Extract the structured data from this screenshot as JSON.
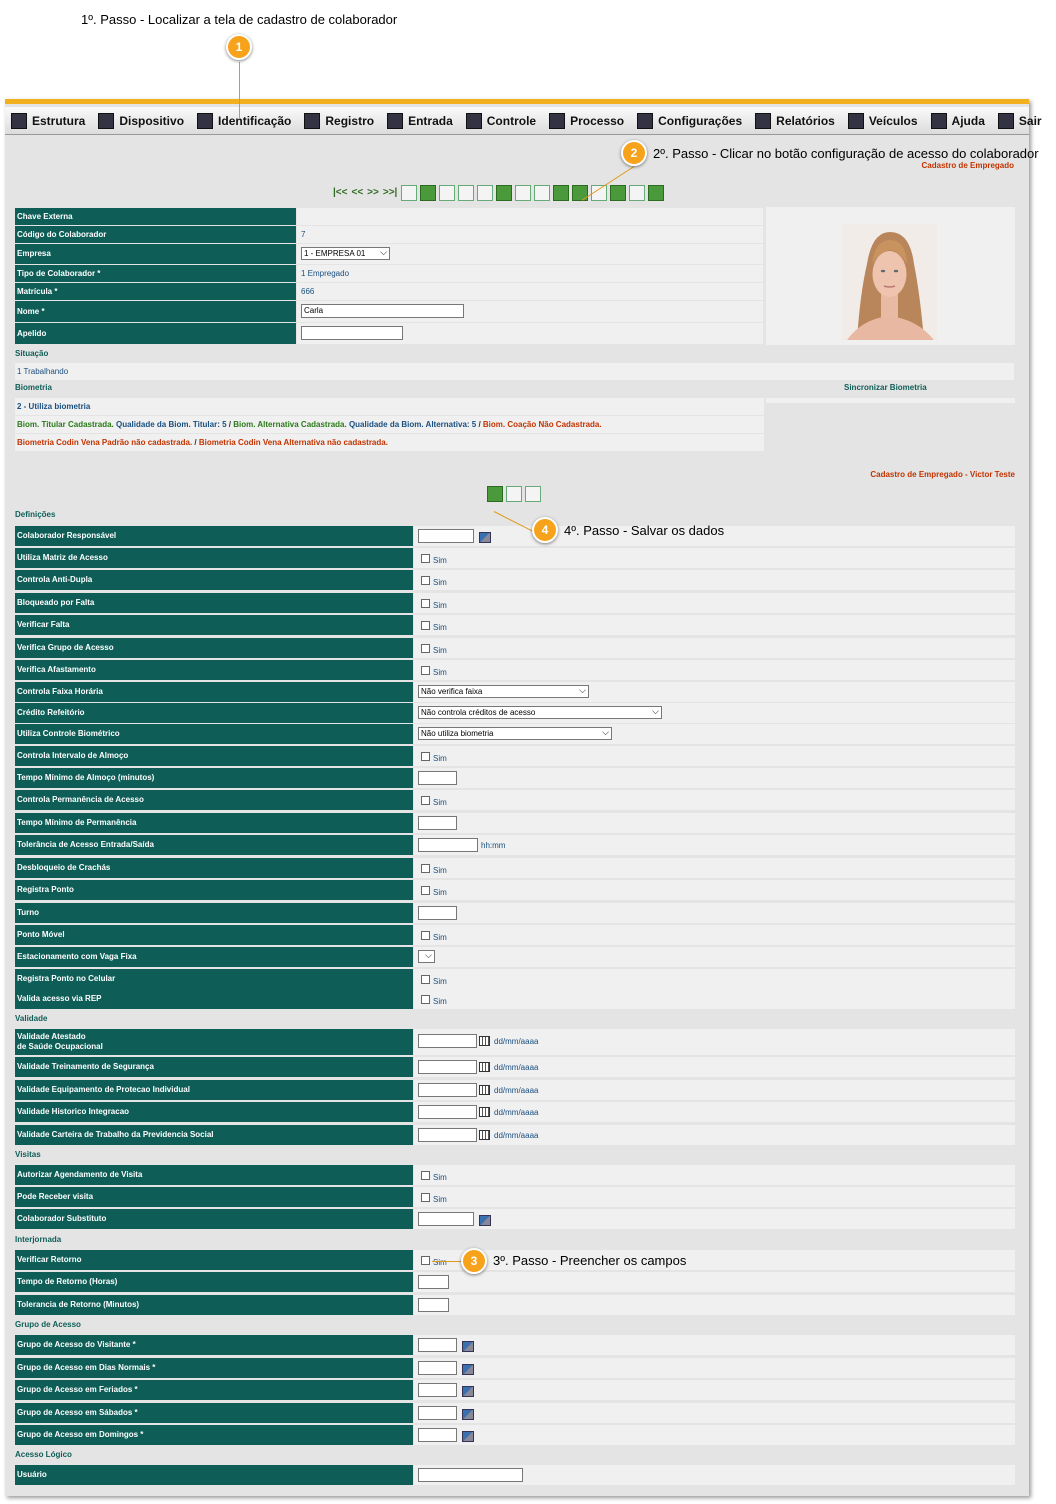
{
  "annotations": {
    "step1": "1º. Passo - Localizar a tela de cadastro de colaborador",
    "step2": "2º. Passo - Clicar no botão configuração de acesso do colaborador",
    "step3": "3º. Passo - Preencher os campos",
    "step4": "4º. Passo - Salvar os dados",
    "markers": [
      "1",
      "2",
      "3",
      "4"
    ]
  },
  "menu": [
    {
      "label": "Estrutura",
      "icon": "structure-icon"
    },
    {
      "label": "Dispositivo",
      "icon": "device-icon"
    },
    {
      "label": "Identificação",
      "icon": "identification-icon"
    },
    {
      "label": "Registro",
      "icon": "register-icon"
    },
    {
      "label": "Entrada",
      "icon": "entry-icon"
    },
    {
      "label": "Controle",
      "icon": "control-icon"
    },
    {
      "label": "Processo",
      "icon": "process-icon"
    },
    {
      "label": "Configurações",
      "icon": "settings-icon"
    },
    {
      "label": "Relatórios",
      "icon": "reports-icon"
    },
    {
      "label": "Veículos",
      "icon": "vehicles-icon"
    },
    {
      "label": "Ajuda",
      "icon": "help-icon"
    },
    {
      "label": "Sair",
      "icon": "exit-icon"
    }
  ],
  "page_title": "Cadastro de Empregado",
  "nav_glyphs": {
    "first": "|<<",
    "prev": "<<",
    "next": ">>",
    "last": ">>|"
  },
  "colaborador": {
    "chave_externa_label": "Chave Externa",
    "codigo_label": "Código do Colaborador",
    "codigo": "7",
    "empresa_label": "Empresa",
    "empresa": "1 - EMPRESA 01",
    "tipo_label": "Tipo de Colaborador *",
    "tipo": "1 Empregado",
    "matricula_label": "Matrícula *",
    "matricula": "666",
    "nome_label": "Nome *",
    "nome": "Carla",
    "apelido_label": "Apelido"
  },
  "situacao": {
    "label": "Situação",
    "value": "1 Trabalhando"
  },
  "biometria": {
    "label": "Biometria",
    "sync_link": "Sincronizar Biometria",
    "value": "2 - Utiliza biometria",
    "status_parts": [
      {
        "text": "Biom. Titular Cadastrada.",
        "color": "#2a7a1a"
      },
      {
        "text": " Qualidade da Biom. Titular: 5",
        "color": "#1a4f80"
      },
      {
        "text": " / ",
        "color": "#333333"
      },
      {
        "text": "Biom. Alternativa Cadastrada.",
        "color": "#2a7a1a"
      },
      {
        "text": " Qualidade da Biom. Alternativa: 5",
        "color": "#1a4f80"
      },
      {
        "text": " / ",
        "color": "#333333"
      },
      {
        "text": "Biom. Coação Não Cadastrada.",
        "color": "#c33300"
      }
    ],
    "codin_parts": [
      {
        "text": "Biometria Codin Vena Padrão não cadastrada.",
        "color": "#c33300"
      },
      {
        "text": " / ",
        "color": "#333333"
      },
      {
        "text": "Biometria Codin Vena Alternativa não cadastrada.",
        "color": "#c33300"
      }
    ]
  },
  "access_title": "Cadastro de Empregado - Victor Teste",
  "sections": {
    "definicoes": "Definições",
    "validade": "Validade",
    "visitas": "Visitas",
    "interjornada": "Interjornada",
    "grupo_acesso": "Grupo de Acesso",
    "acesso_logico": "Acesso Lógico"
  },
  "checkbox_label": "Sim",
  "date_hint": "dd/mm/aaaa",
  "time_hint": "hh:mm",
  "fields": {
    "colaborador_responsavel": "Colaborador Responsável",
    "utiliza_matriz": "Utiliza Matriz de Acesso",
    "anti_dupla": "Controla Anti-Dupla",
    "bloqueado_falta": "Bloqueado por Falta",
    "verificar_falta": "Verificar Falta",
    "verifica_grupo": "Verifica Grupo de Acesso",
    "verifica_afastamento": "Verifica Afastamento",
    "faixa_horaria": "Controla Faixa Horária",
    "faixa_horaria_value": "Não verifica faixa",
    "credito_refeitorio": "Crédito Refeitório",
    "credito_refeitorio_value": "Não controla créditos de acesso",
    "controle_biometrico": "Utiliza Controle Biométrico",
    "controle_biometrico_value": "Não utiliza biometria",
    "intervalo_almoco": "Controla Intervalo de Almoço",
    "tempo_almoco": "Tempo Mínimo de Almoço (minutos)",
    "permanencia": "Controla Permanência de Acesso",
    "tempo_permanencia": "Tempo Mínimo de Permanência",
    "tolerancia_entrada_saida": "Tolerância de Acesso Entrada/Saída",
    "desbloqueio_crachas": "Desbloqueio de Crachás",
    "registra_ponto": "Registra Ponto",
    "turno": "Turno",
    "ponto_movel": "Ponto Móvel",
    "vaga_fixa": "Estacionamento com Vaga Fixa",
    "ponto_celular": "Registra Ponto no Celular",
    "valida_rep": "Valida acesso via REP",
    "atestado_1": "Validade Atestado",
    "atestado_2": "de Saúde Ocupacional",
    "treinamento": "Validade Treinamento de Segurança",
    "epi": "Validade Equipamento de Protecao Individual",
    "integracao": "Validade Historico Integracao",
    "carteira": "Validade Carteira de Trabalho da Previdencia Social",
    "agendamento_visita": "Autorizar Agendamento de Visita",
    "receber_visita": "Pode Receber visita",
    "substituto": "Colaborador Substituto",
    "verificar_retorno": "Verificar Retorno",
    "tempo_retorno": "Tempo de Retorno (Horas)",
    "tolerancia_retorno": "Tolerancia de Retorno (Minutos)",
    "grupo_visitante": "Grupo de Acesso do Visitante *",
    "grupo_normais": "Grupo de Acesso em Dias Normais *",
    "grupo_feriados": "Grupo de Acesso em Feriados *",
    "grupo_sabados": "Grupo de Acesso em Sábados *",
    "grupo_domingos": "Grupo de Acesso em Domingos *",
    "usuario": "Usuário"
  }
}
